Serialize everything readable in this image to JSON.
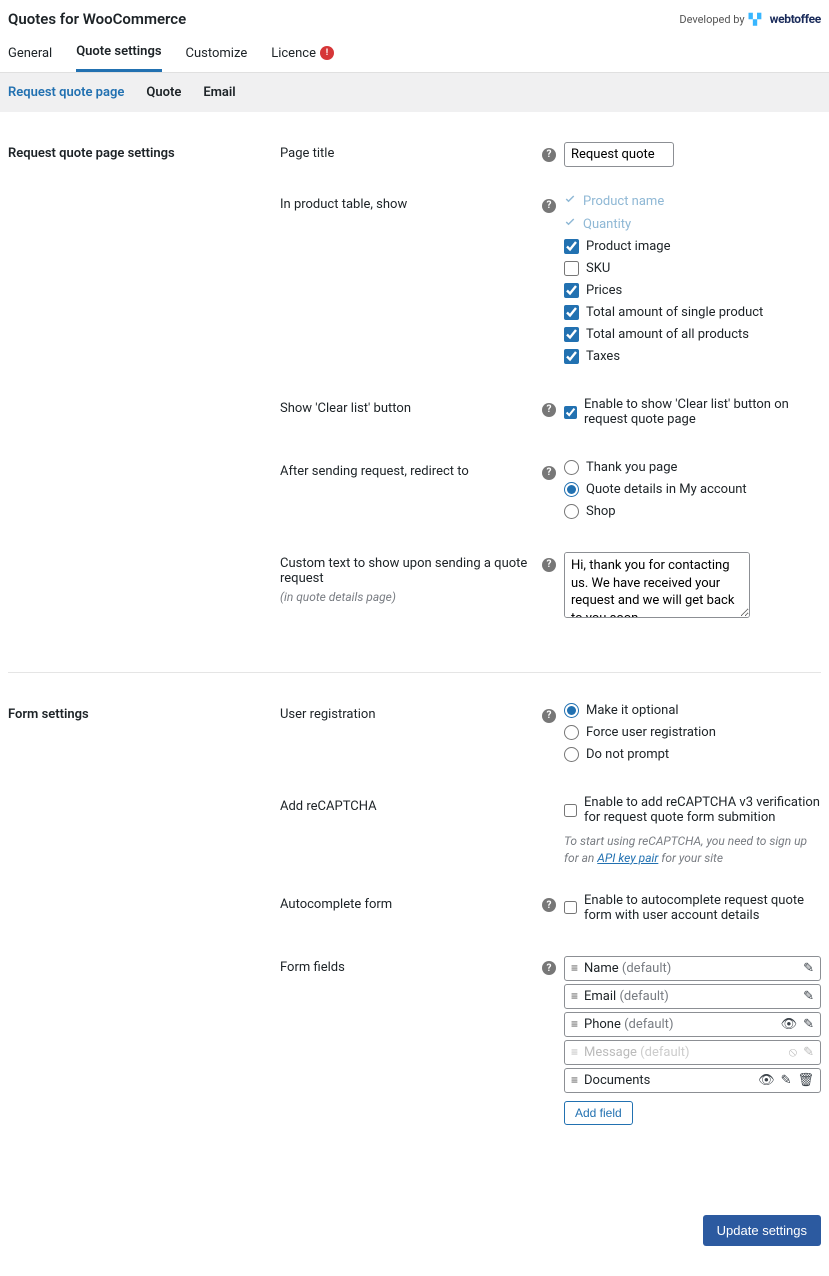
{
  "header": {
    "title": "Quotes for WooCommerce",
    "developed_by": "Developed by",
    "logo_text": "webtoffee"
  },
  "tabs": {
    "items": [
      {
        "label": "General",
        "active": false
      },
      {
        "label": "Quote settings",
        "active": true
      },
      {
        "label": "Customize",
        "active": false
      },
      {
        "label": "Licence",
        "active": false,
        "alert": "!"
      }
    ]
  },
  "subtabs": {
    "items": [
      {
        "label": "Request quote page",
        "active": true
      },
      {
        "label": "Quote",
        "active": false
      },
      {
        "label": "Email",
        "active": false
      }
    ]
  },
  "section1": {
    "title": "Request quote page settings",
    "page_title_label": "Page title",
    "page_title_value": "Request quote",
    "inproduct_label": "In product table, show",
    "inproduct_options": [
      {
        "label": "Product name",
        "checked": true,
        "locked": true
      },
      {
        "label": "Quantity",
        "checked": true,
        "locked": true
      },
      {
        "label": "Product image",
        "checked": true,
        "locked": false
      },
      {
        "label": "SKU",
        "checked": false,
        "locked": false
      },
      {
        "label": "Prices",
        "checked": true,
        "locked": false
      },
      {
        "label": "Total amount of single product",
        "checked": true,
        "locked": false
      },
      {
        "label": "Total amount of all products",
        "checked": true,
        "locked": false
      },
      {
        "label": "Taxes",
        "checked": true,
        "locked": false
      }
    ],
    "clearlist_label": "Show 'Clear list' button",
    "clearlist_option": "Enable to show 'Clear list' button on request quote page",
    "clearlist_checked": true,
    "redirect_label": "After sending request, redirect to",
    "redirect_options": [
      {
        "label": "Thank you page",
        "checked": false
      },
      {
        "label": "Quote details in My account",
        "checked": true
      },
      {
        "label": "Shop",
        "checked": false
      }
    ],
    "customtext_label": "Custom text to show upon sending a quote request",
    "customtext_sub": "(in quote details page)",
    "customtext_value": "Hi, thank you for contacting us. We have received your request and we will get back to you soon."
  },
  "section2": {
    "title": "Form settings",
    "userreg_label": "User registration",
    "userreg_options": [
      {
        "label": "Make it optional",
        "checked": true
      },
      {
        "label": "Force user registration",
        "checked": false
      },
      {
        "label": "Do not prompt",
        "checked": false
      }
    ],
    "recaptcha_label": "Add reCAPTCHA",
    "recaptcha_option": "Enable to add reCAPTCHA v3 verification for request quote form submition",
    "recaptcha_checked": false,
    "recaptcha_note_pre": "To start using reCAPTCHA, you need to sign up for an ",
    "recaptcha_note_link": "API key pair",
    "recaptcha_note_post": " for your site",
    "autocomplete_label": "Autocomplete form",
    "autocomplete_option": "Enable to autocomplete request quote form with user account details",
    "autocomplete_checked": false,
    "formfields_label": "Form fields",
    "formfields": [
      {
        "name": "Name",
        "suffix": "(default)",
        "actions": [
          "edit"
        ],
        "muted": false
      },
      {
        "name": "Email",
        "suffix": "(default)",
        "actions": [
          "edit"
        ],
        "muted": false
      },
      {
        "name": "Phone",
        "suffix": "(default)",
        "actions": [
          "eye",
          "edit"
        ],
        "muted": false
      },
      {
        "name": "Message",
        "suffix": "(default)",
        "actions": [
          "eye-off",
          "edit"
        ],
        "muted": true
      },
      {
        "name": "Documents",
        "suffix": "",
        "actions": [
          "eye",
          "edit",
          "trash"
        ],
        "muted": false
      }
    ],
    "addfield_label": "Add field"
  },
  "footer": {
    "update_label": "Update settings"
  }
}
